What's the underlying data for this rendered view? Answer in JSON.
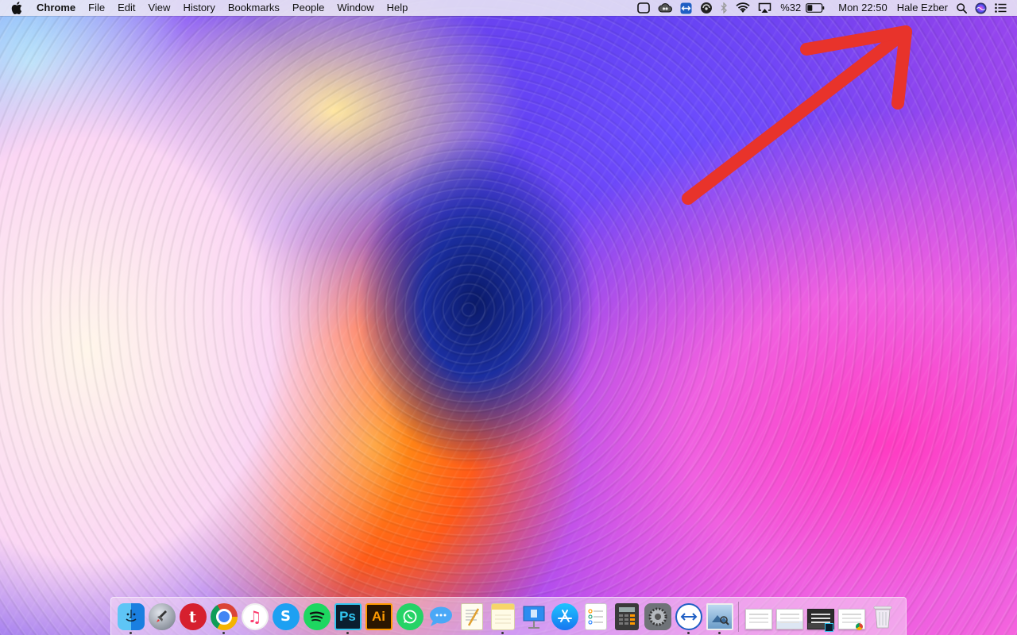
{
  "menubar": {
    "apple_icon": "apple-logo-icon",
    "app_name": "Chrome",
    "menus": [
      "File",
      "Edit",
      "View",
      "History",
      "Bookmarks",
      "People",
      "Window",
      "Help"
    ],
    "status": {
      "battery_percent": "%32",
      "clock": "Mon 22:50",
      "user": "Hale Ezber"
    },
    "status_icons": [
      "screen-record-icon",
      "creative-cloud-icon",
      "teamviewer-icon",
      "scanner-icon",
      "bluetooth-icon",
      "wifi-icon",
      "airplay-icon",
      "battery-icon",
      "spotlight-search-icon",
      "siri-icon",
      "notification-center-icon"
    ]
  },
  "annotation": {
    "arrow_color": "#e8332b"
  },
  "dock": {
    "apps": [
      {
        "name": "Finder",
        "icon": "finder-icon",
        "running": true
      },
      {
        "name": "Launchpad",
        "icon": "launchpad-icon",
        "running": false
      },
      {
        "name": "Tumblr",
        "icon": "tumblr-icon",
        "running": false
      },
      {
        "name": "Google Chrome",
        "icon": "chrome-icon",
        "running": true
      },
      {
        "name": "iTunes",
        "icon": "itunes-icon",
        "running": false
      },
      {
        "name": "Shazam",
        "icon": "shazam-icon",
        "running": false
      },
      {
        "name": "Spotify",
        "icon": "spotify-icon",
        "running": false
      },
      {
        "name": "Photoshop",
        "icon": "photoshop-icon",
        "label": "Ps",
        "running": true
      },
      {
        "name": "Illustrator",
        "icon": "illustrator-icon",
        "label": "Ai",
        "running": false
      },
      {
        "name": "WhatsApp",
        "icon": "whatsapp-icon",
        "running": false
      },
      {
        "name": "Messages",
        "icon": "messages-icon",
        "running": false
      },
      {
        "name": "TextEdit",
        "icon": "textedit-icon",
        "running": false
      },
      {
        "name": "Notes",
        "icon": "notes-icon",
        "running": true
      },
      {
        "name": "Keynote",
        "icon": "keynote-icon",
        "running": false
      },
      {
        "name": "App Store",
        "icon": "app-store-icon",
        "running": false
      },
      {
        "name": "Reminders",
        "icon": "reminders-icon",
        "running": false
      },
      {
        "name": "Calculator",
        "icon": "calculator-icon",
        "running": false
      },
      {
        "name": "System Preferences",
        "icon": "system-preferences-icon",
        "running": false
      },
      {
        "name": "TeamViewer",
        "icon": "teamviewer-icon",
        "running": true
      },
      {
        "name": "Preview",
        "icon": "preview-icon",
        "running": true
      }
    ],
    "documents": [
      {
        "icon": "document-thumbnail-icon"
      },
      {
        "icon": "document-thumbnail-icon"
      },
      {
        "icon": "photoshop-window-thumbnail-icon"
      },
      {
        "icon": "chrome-window-thumbnail-icon"
      }
    ],
    "trash_icon": "trash-icon"
  }
}
